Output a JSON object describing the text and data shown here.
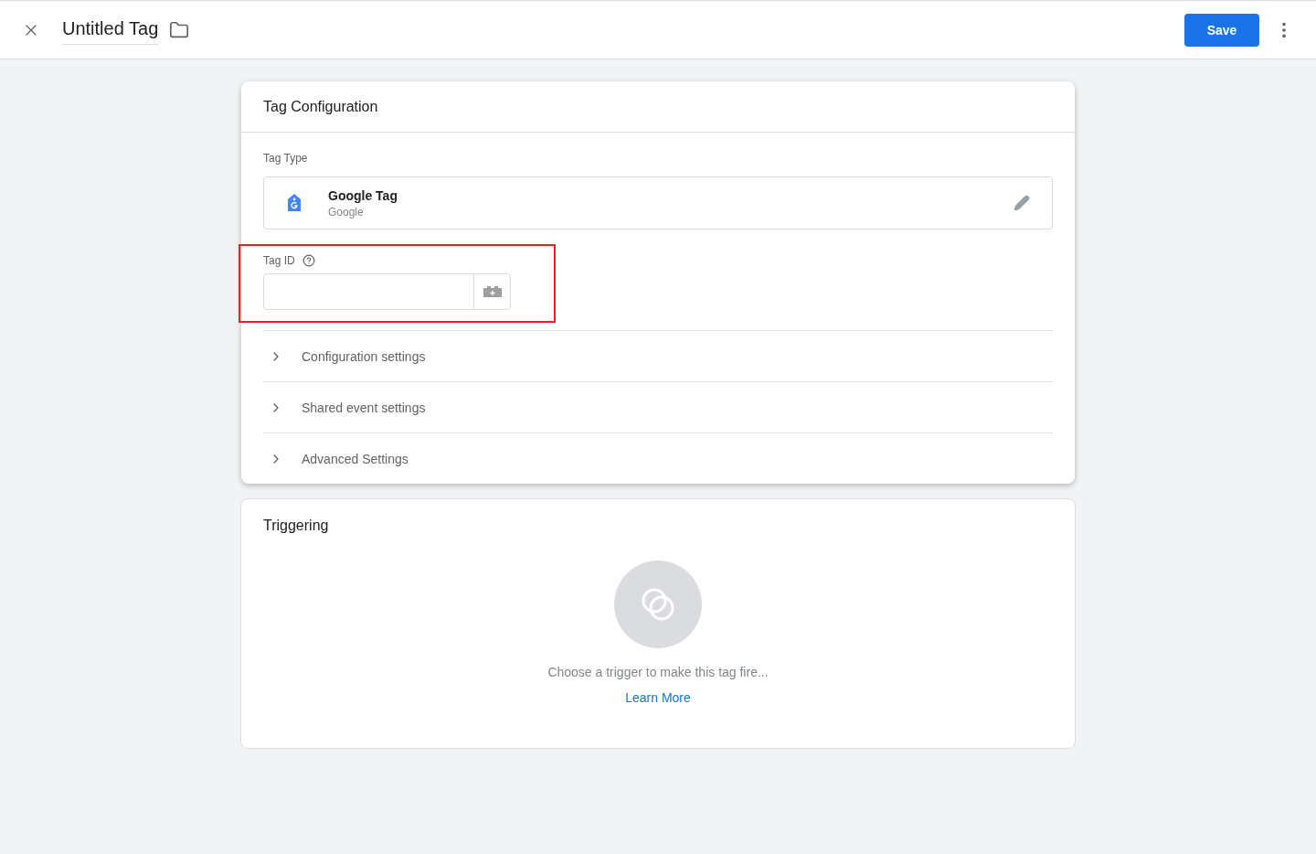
{
  "header": {
    "title": "Untitled Tag",
    "save_label": "Save"
  },
  "tag_configuration": {
    "title": "Tag Configuration",
    "tag_type_label": "Tag Type",
    "tag_type": {
      "name": "Google Tag",
      "vendor": "Google"
    },
    "tag_id": {
      "label": "Tag ID",
      "highlighted": true
    },
    "sections": [
      {
        "label": "Configuration settings",
        "expanded": false
      },
      {
        "label": "Shared event settings",
        "expanded": false
      },
      {
        "label": "Advanced Settings",
        "expanded": false
      }
    ]
  },
  "triggering": {
    "title": "Triggering",
    "message": "Choose a trigger to make this tag fire...",
    "link": "Learn More"
  }
}
